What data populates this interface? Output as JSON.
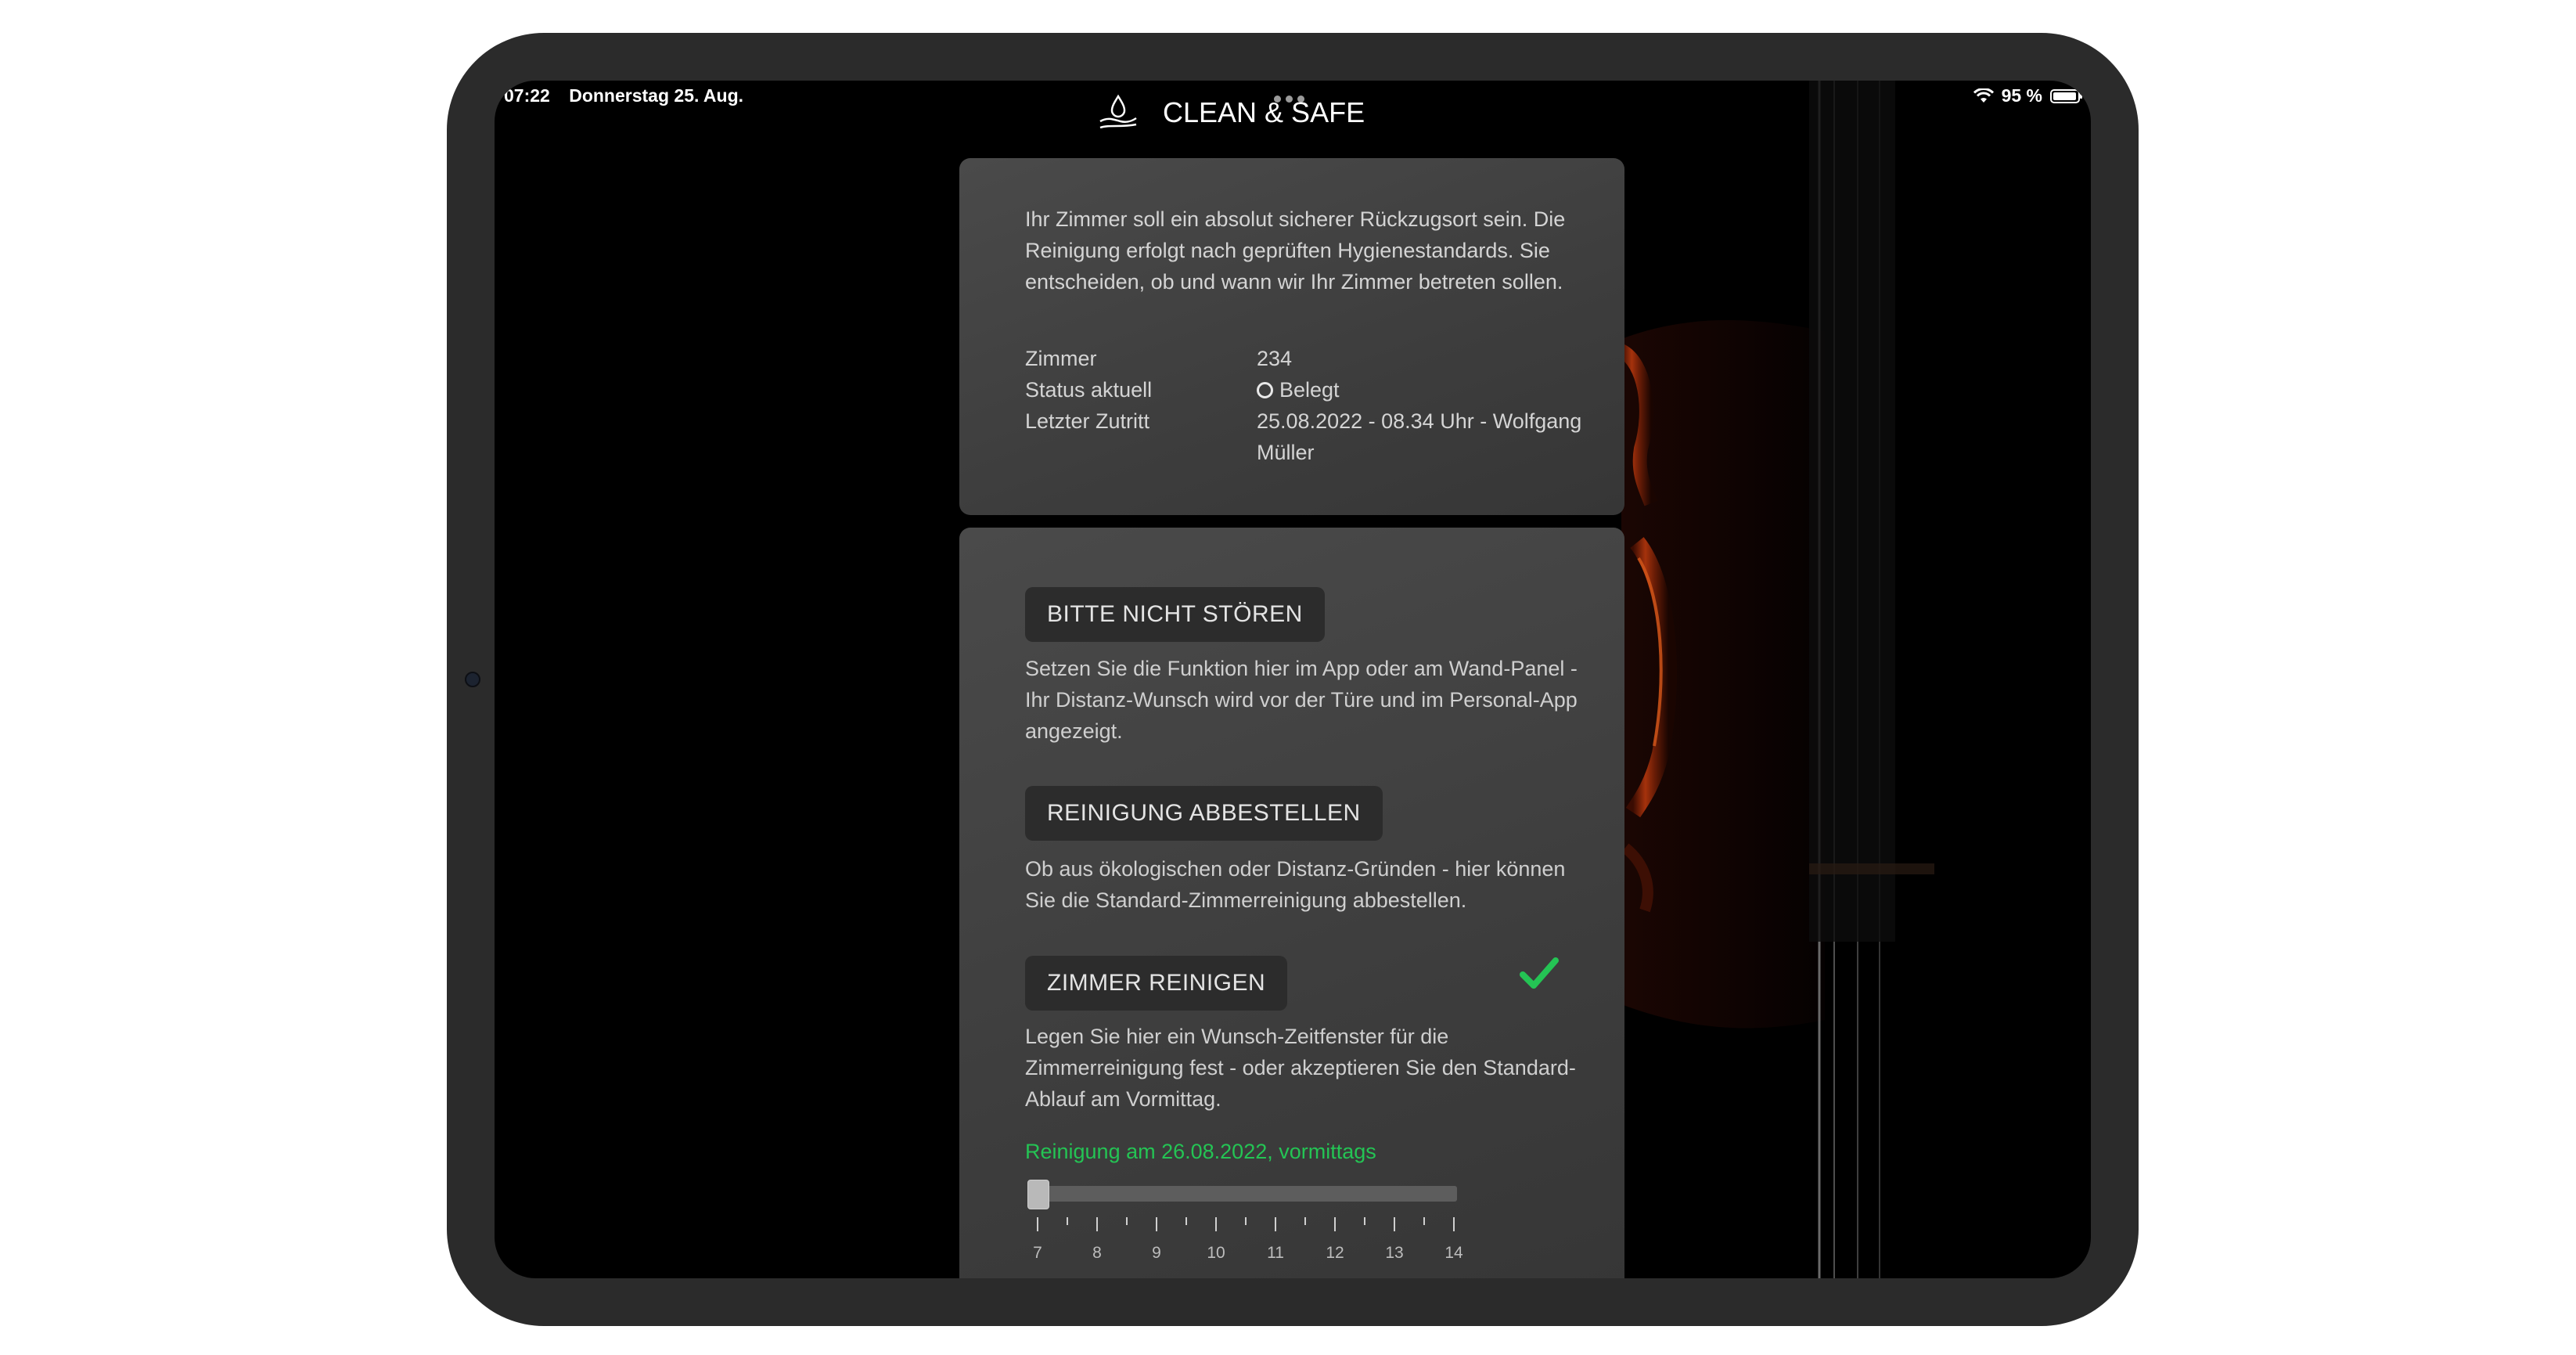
{
  "status_bar": {
    "time": "07:22",
    "date": "Donnerstag 25. Aug.",
    "battery": "95 %",
    "wifi_icon": "wifi-icon",
    "battery_icon": "battery-icon"
  },
  "header": {
    "title": "CLEAN & SAFE",
    "logo_icon": "drop-in-hand-icon"
  },
  "info_card": {
    "intro": "Ihr Zimmer soll ein absolut sicherer Rückzugsort sein. Die Reinigung erfolgt nach geprüften Hygienestandards. Sie entscheiden, ob und wann wir Ihr Zimmer betreten sollen.",
    "room_label": "Zimmer",
    "room_value": "234",
    "status_label": "Status aktuell",
    "status_value": "Belegt",
    "last_access_label": "Letzter Zutritt",
    "last_access_value": "25.08.2022 - 08.34 Uhr - Wolfgang Müller"
  },
  "actions": {
    "dnd": {
      "label": "BITTE NICHT STÖREN",
      "description": "Setzen Sie die Funktion hier im App oder am Wand-Panel - Ihr Distanz-Wunsch wird vor der Türe und im Personal-App angezeigt."
    },
    "cancel_cleaning": {
      "label": "REINIGUNG ABBESTELLEN",
      "description": "Ob aus ökologischen oder Distanz-Gründen - hier können Sie die Standard-Zimmerreinigung abbestellen."
    },
    "clean_room": {
      "label": "ZIMMER REINIGEN",
      "description": "Legen Sie hier ein Wunsch-Zeitfenster für die Zimmerreinigung fest - oder akzeptieren Sie den Standard-Ablauf am Vormittag.",
      "selected": true,
      "check_icon": "checkmark-icon"
    }
  },
  "schedule": {
    "confirmation": "Reinigung am 26.08.2022, vormittags",
    "slider_value": 7,
    "slider_min": 7,
    "slider_max": 14,
    "tick_labels": [
      "7",
      "8",
      "9",
      "10",
      "11",
      "12",
      "13",
      "14"
    ]
  },
  "colors": {
    "accent_green": "#24c454",
    "card_bg": "#414141",
    "button_bg": "#2c2c2c"
  }
}
